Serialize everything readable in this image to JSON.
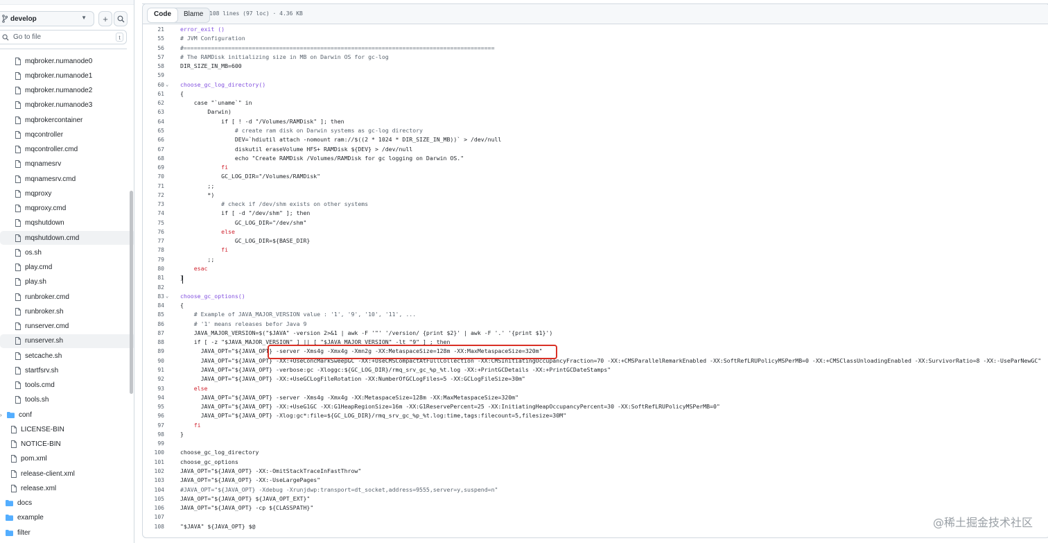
{
  "sidebar": {
    "branch": "develop",
    "goto_placeholder": "Go to file",
    "goto_shortcut": "t",
    "items": [
      {
        "label": "mqbroker.numanode0",
        "type": "file"
      },
      {
        "label": "mqbroker.numanode1",
        "type": "file"
      },
      {
        "label": "mqbroker.numanode2",
        "type": "file"
      },
      {
        "label": "mqbroker.numanode3",
        "type": "file"
      },
      {
        "label": "mqbrokercontainer",
        "type": "file"
      },
      {
        "label": "mqcontroller",
        "type": "file"
      },
      {
        "label": "mqcontroller.cmd",
        "type": "file"
      },
      {
        "label": "mqnamesrv",
        "type": "file"
      },
      {
        "label": "mqnamesrv.cmd",
        "type": "file"
      },
      {
        "label": "mqproxy",
        "type": "file"
      },
      {
        "label": "mqproxy.cmd",
        "type": "file"
      },
      {
        "label": "mqshutdown",
        "type": "file"
      },
      {
        "label": "mqshutdown.cmd",
        "type": "file",
        "selected": true
      },
      {
        "label": "os.sh",
        "type": "file"
      },
      {
        "label": "play.cmd",
        "type": "file"
      },
      {
        "label": "play.sh",
        "type": "file"
      },
      {
        "label": "runbroker.cmd",
        "type": "file"
      },
      {
        "label": "runbroker.sh",
        "type": "file"
      },
      {
        "label": "runserver.cmd",
        "type": "file"
      },
      {
        "label": "runserver.sh",
        "type": "file",
        "selected": true
      },
      {
        "label": "setcache.sh",
        "type": "file"
      },
      {
        "label": "startfsrv.sh",
        "type": "file"
      },
      {
        "label": "tools.cmd",
        "type": "file"
      },
      {
        "label": "tools.sh",
        "type": "file"
      },
      {
        "label": "conf",
        "type": "folder"
      },
      {
        "label": "LICENSE-BIN",
        "type": "file"
      },
      {
        "label": "NOTICE-BIN",
        "type": "file"
      },
      {
        "label": "pom.xml",
        "type": "file"
      },
      {
        "label": "release-client.xml",
        "type": "file"
      },
      {
        "label": "release.xml",
        "type": "file"
      },
      {
        "label": "docs",
        "type": "folder"
      },
      {
        "label": "example",
        "type": "folder"
      },
      {
        "label": "filter",
        "type": "folder"
      }
    ]
  },
  "toolbar": {
    "code_tab": "Code",
    "blame_tab": "Blame",
    "file_info": "108 lines (97 loc) · 4.36 KB"
  },
  "colors": {
    "keyword": "#cf222e",
    "function": "#8250df",
    "string": "#0a3069",
    "comment": "#59636e",
    "highlight_box": "#d93025"
  },
  "code_lines": [
    {
      "n": "21",
      "text": "error_exit ()",
      "cls": "fn"
    },
    {
      "n": "55",
      "text": "# JVM Configuration",
      "cls": "cm"
    },
    {
      "n": "56",
      "text": "#===========================================================================================",
      "cls": "cm"
    },
    {
      "n": "57",
      "text": "# The RAMDisk initializing size in MB on Darwin OS for gc-log",
      "cls": "cm"
    },
    {
      "n": "58",
      "text": "DIR_SIZE_IN_MB=600",
      "cls": ""
    },
    {
      "n": "59",
      "text": "",
      "cls": ""
    },
    {
      "n": "60",
      "text": "choose_gc_log_directory()",
      "cls": "fn",
      "fold": true
    },
    {
      "n": "61",
      "text": "{",
      "cls": ""
    },
    {
      "n": "62",
      "text": "    case \"`uname`\" in",
      "cls": ""
    },
    {
      "n": "63",
      "text": "        Darwin)",
      "cls": ""
    },
    {
      "n": "64",
      "text": "            if [ ! -d \"/Volumes/RAMDisk\" ]; then",
      "cls": ""
    },
    {
      "n": "65",
      "text": "                # create ram disk on Darwin systems as gc-log directory",
      "cls": "cm"
    },
    {
      "n": "66",
      "text": "                DEV=`hdiutil attach -nomount ram://$((2 * 1024 * DIR_SIZE_IN_MB))` > /dev/null",
      "cls": ""
    },
    {
      "n": "67",
      "text": "                diskutil eraseVolume HFS+ RAMDisk ${DEV} > /dev/null",
      "cls": ""
    },
    {
      "n": "68",
      "text": "                echo \"Create RAMDisk /Volumes/RAMDisk for gc logging on Darwin OS.\"",
      "cls": ""
    },
    {
      "n": "69",
      "text": "            fi",
      "cls": "kw"
    },
    {
      "n": "70",
      "text": "            GC_LOG_DIR=\"/Volumes/RAMDisk\"",
      "cls": ""
    },
    {
      "n": "71",
      "text": "        ;;",
      "cls": ""
    },
    {
      "n": "72",
      "text": "        *)",
      "cls": ""
    },
    {
      "n": "73",
      "text": "            # check if /dev/shm exists on other systems",
      "cls": "cm"
    },
    {
      "n": "74",
      "text": "            if [ -d \"/dev/shm\" ]; then",
      "cls": ""
    },
    {
      "n": "75",
      "text": "                GC_LOG_DIR=\"/dev/shm\"",
      "cls": ""
    },
    {
      "n": "76",
      "text": "            else",
      "cls": "kw"
    },
    {
      "n": "77",
      "text": "                GC_LOG_DIR=${BASE_DIR}",
      "cls": ""
    },
    {
      "n": "78",
      "text": "            fi",
      "cls": "kw"
    },
    {
      "n": "79",
      "text": "        ;;",
      "cls": ""
    },
    {
      "n": "80",
      "text": "    esac",
      "cls": "kw"
    },
    {
      "n": "81",
      "text": "}",
      "cls": ""
    },
    {
      "n": "82",
      "text": "",
      "cls": ""
    },
    {
      "n": "83",
      "text": "choose_gc_options()",
      "cls": "fn",
      "fold": true
    },
    {
      "n": "84",
      "text": "{",
      "cls": ""
    },
    {
      "n": "85",
      "text": "    # Example of JAVA_MAJOR_VERSION value : '1', '9', '10', '11', ...",
      "cls": "cm"
    },
    {
      "n": "86",
      "text": "    # '1' means releases befor Java 9",
      "cls": "cm"
    },
    {
      "n": "87",
      "text": "    JAVA_MAJOR_VERSION=$(\"$JAVA\" -version 2>&1 | awk -F '\"' '/version/ {print $2}' | awk -F '.' '{print $1}')",
      "cls": ""
    },
    {
      "n": "88",
      "text": "    if [ -z \"$JAVA_MAJOR_VERSION\" ] || [ \"$JAVA_MAJOR_VERSION\" -lt \"9\" ] ; then",
      "cls": ""
    },
    {
      "n": "89",
      "text": "      JAVA_OPT=\"${JAVA_OPT} -server -Xms4g -Xmx4g -Xmn2g -XX:MetaspaceSize=128m -XX:MaxMetaspaceSize=320m\"",
      "cls": ""
    },
    {
      "n": "90",
      "text": "      JAVA_OPT=\"${JAVA_OPT} -XX:+UseConcMarkSweepGC -XX:+UseCMSCompactAtFullCollection -XX:CMSInitiatingOccupancyFraction=70 -XX:+CMSParallelRemarkEnabled -XX:SoftRefLRUPolicyMSPerMB=0 -XX:+CMSClassUnloadingEnabled -XX:SurvivorRatio=8 -XX:-UseParNewGC\"",
      "cls": ""
    },
    {
      "n": "91",
      "text": "      JAVA_OPT=\"${JAVA_OPT} -verbose:gc -Xloggc:${GC_LOG_DIR}/rmq_srv_gc_%p_%t.log -XX:+PrintGCDetails -XX:+PrintGCDateStamps\"",
      "cls": ""
    },
    {
      "n": "92",
      "text": "      JAVA_OPT=\"${JAVA_OPT} -XX:+UseGCLogFileRotation -XX:NumberOfGCLogFiles=5 -XX:GCLogFileSize=30m\"",
      "cls": ""
    },
    {
      "n": "93",
      "text": "    else",
      "cls": "kw"
    },
    {
      "n": "94",
      "text": "      JAVA_OPT=\"${JAVA_OPT} -server -Xms4g -Xmx4g -XX:MetaspaceSize=128m -XX:MaxMetaspaceSize=320m\"",
      "cls": ""
    },
    {
      "n": "95",
      "text": "      JAVA_OPT=\"${JAVA_OPT} -XX:+UseG1GC -XX:G1HeapRegionSize=16m -XX:G1ReservePercent=25 -XX:InitiatingHeapOccupancyPercent=30 -XX:SoftRefLRUPolicyMSPerMB=0\"",
      "cls": ""
    },
    {
      "n": "96",
      "text": "      JAVA_OPT=\"${JAVA_OPT} -Xlog:gc*:file=${GC_LOG_DIR}/rmq_srv_gc_%p_%t.log:time,tags:filecount=5,filesize=30M\"",
      "cls": ""
    },
    {
      "n": "97",
      "text": "    fi",
      "cls": "kw"
    },
    {
      "n": "98",
      "text": "}",
      "cls": ""
    },
    {
      "n": "99",
      "text": "",
      "cls": ""
    },
    {
      "n": "100",
      "text": "choose_gc_log_directory",
      "cls": ""
    },
    {
      "n": "101",
      "text": "choose_gc_options",
      "cls": ""
    },
    {
      "n": "102",
      "text": "JAVA_OPT=\"${JAVA_OPT} -XX:-OmitStackTraceInFastThrow\"",
      "cls": ""
    },
    {
      "n": "103",
      "text": "JAVA_OPT=\"${JAVA_OPT} -XX:-UseLargePages\"",
      "cls": ""
    },
    {
      "n": "104",
      "text": "#JAVA_OPT=\"${JAVA_OPT} -Xdebug -Xrunjdwp:transport=dt_socket,address=9555,server=y,suspend=n\"",
      "cls": "cm"
    },
    {
      "n": "105",
      "text": "JAVA_OPT=\"${JAVA_OPT} ${JAVA_OPT_EXT}\"",
      "cls": ""
    },
    {
      "n": "106",
      "text": "JAVA_OPT=\"${JAVA_OPT} -cp ${CLASSPATH}\"",
      "cls": ""
    },
    {
      "n": "107",
      "text": "",
      "cls": ""
    },
    {
      "n": "108",
      "text": "\"$JAVA\" ${JAVA_OPT} $@",
      "cls": ""
    }
  ],
  "watermark": "@稀土掘金技术社区"
}
